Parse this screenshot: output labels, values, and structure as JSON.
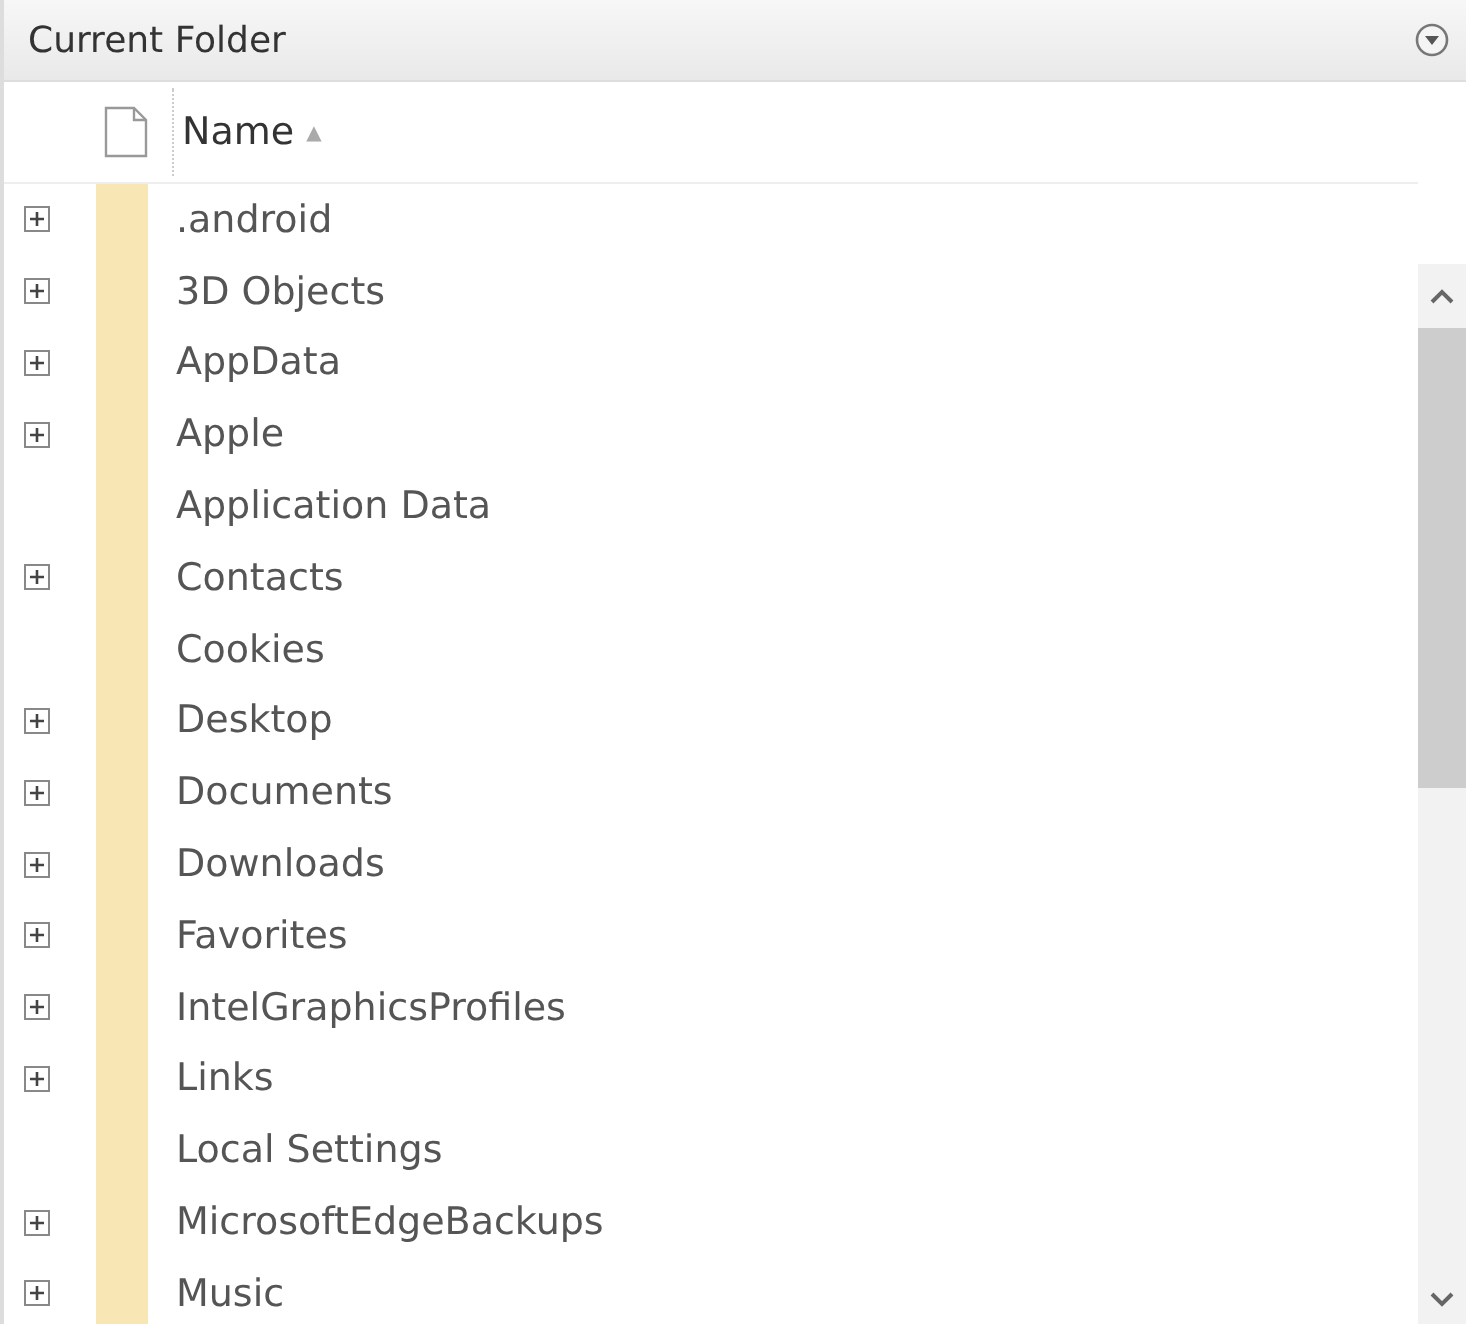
{
  "panel": {
    "title": "Current Folder"
  },
  "column": {
    "label": "Name",
    "sort_icon": "▲"
  },
  "rows": [
    {
      "name": ".android",
      "expandable": true
    },
    {
      "name": "3D Objects",
      "expandable": true
    },
    {
      "name": "AppData",
      "expandable": true
    },
    {
      "name": "Apple",
      "expandable": true
    },
    {
      "name": "Application Data",
      "expandable": false
    },
    {
      "name": "Contacts",
      "expandable": true
    },
    {
      "name": "Cookies",
      "expandable": false
    },
    {
      "name": "Desktop",
      "expandable": true
    },
    {
      "name": "Documents",
      "expandable": true
    },
    {
      "name": "Downloads",
      "expandable": true
    },
    {
      "name": "Favorites",
      "expandable": true
    },
    {
      "name": "IntelGraphicsProfiles",
      "expandable": true
    },
    {
      "name": "Links",
      "expandable": true
    },
    {
      "name": "Local Settings",
      "expandable": false
    },
    {
      "name": "MicrosoftEdgeBackups",
      "expandable": true
    },
    {
      "name": "Music",
      "expandable": true
    }
  ]
}
